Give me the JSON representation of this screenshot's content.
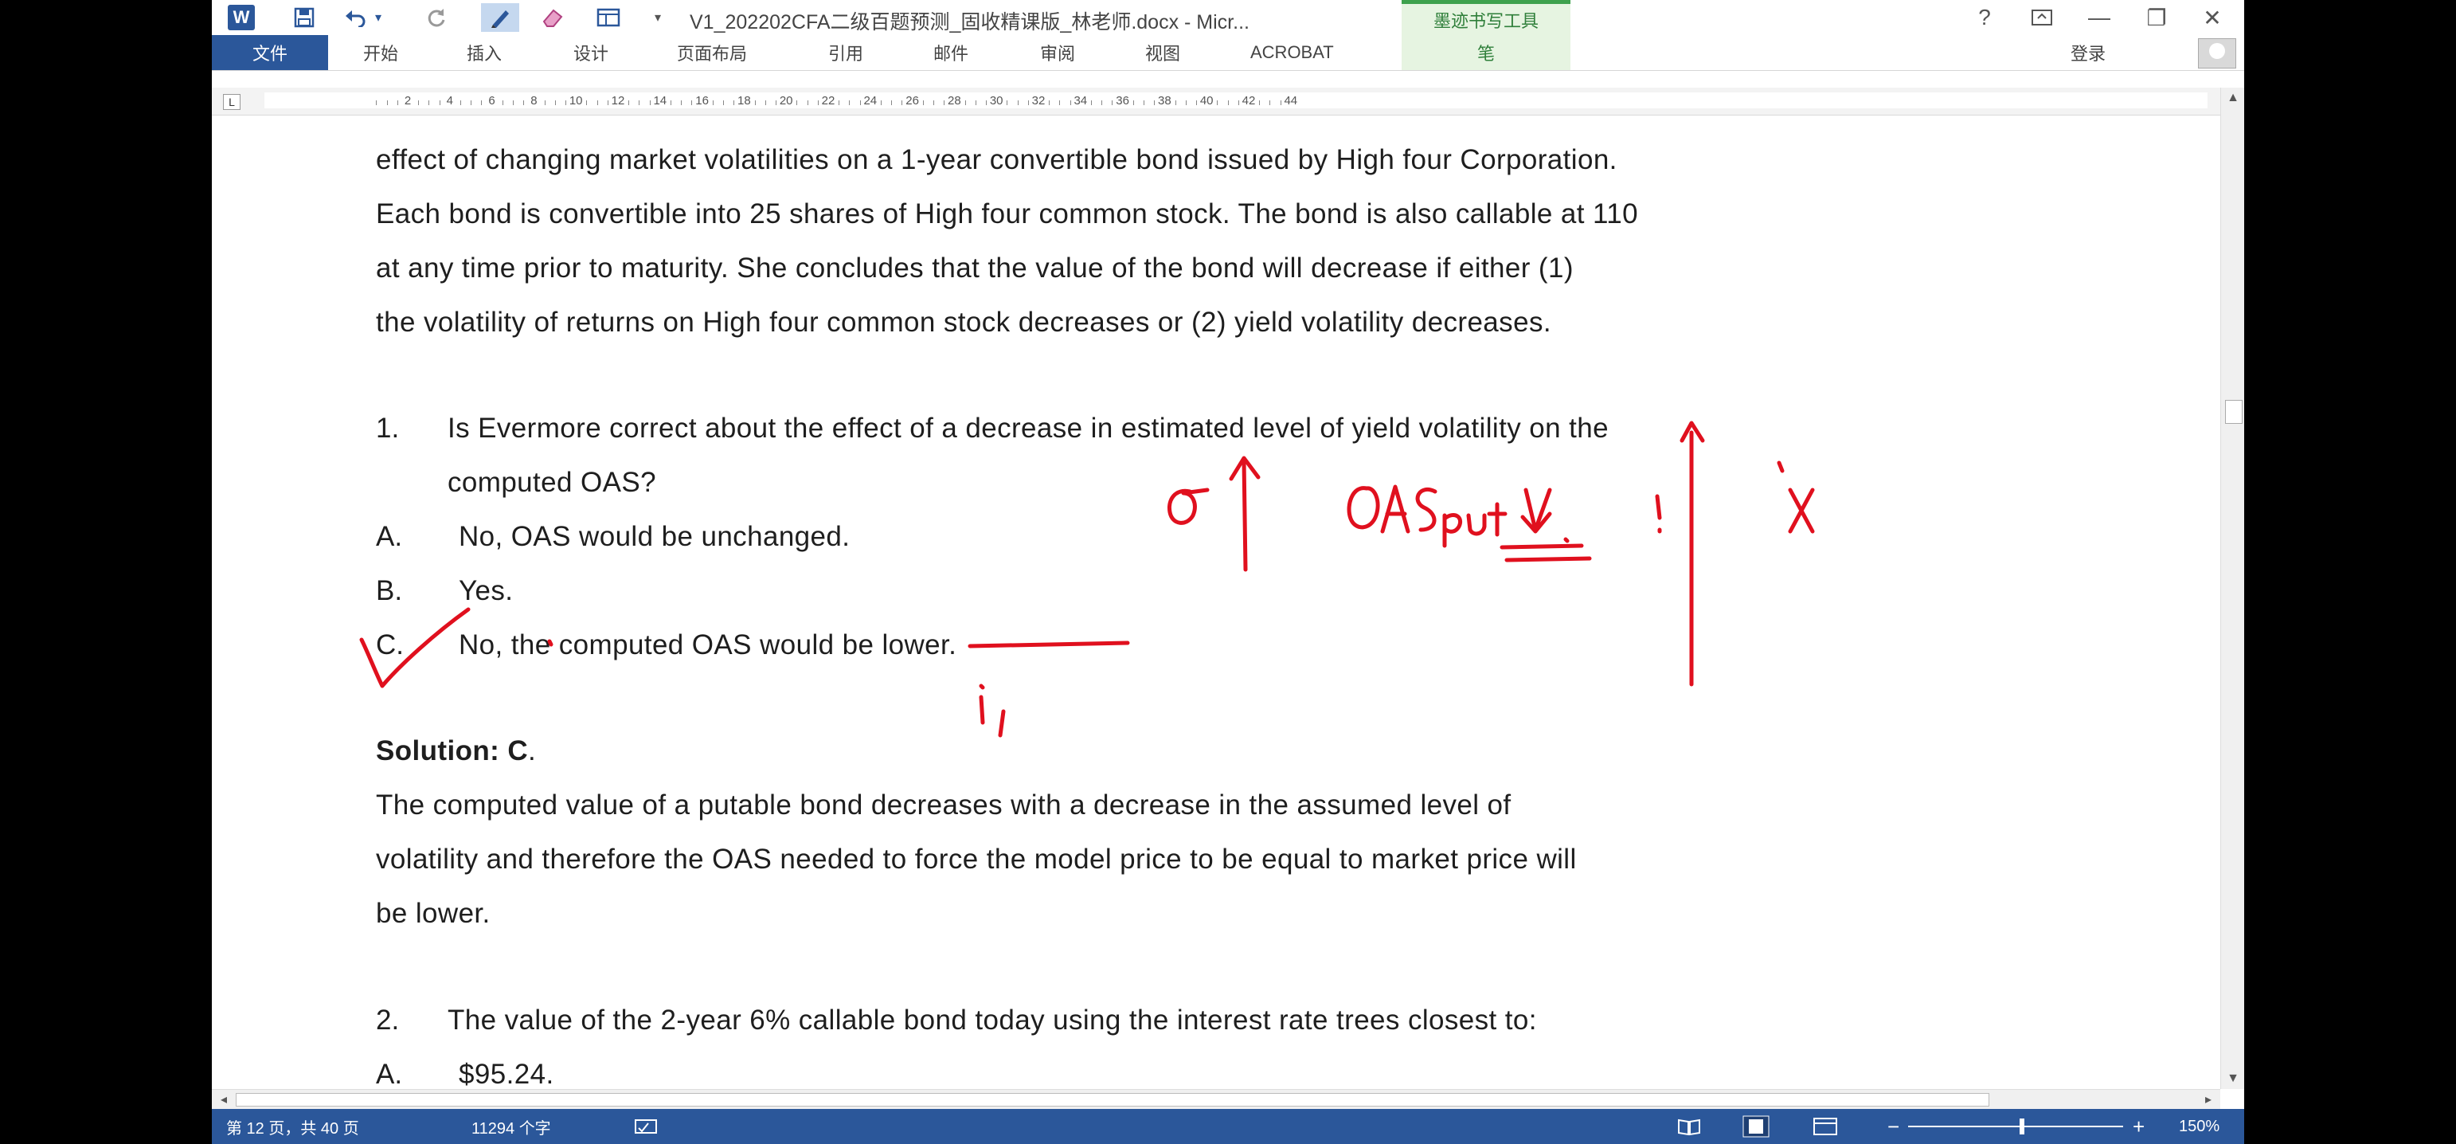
{
  "window": {
    "title": "V1_202202CFA二级百题预测_固收精课版_林老师.docx - Micr...",
    "contextual_tab_group": "墨迹书写工具",
    "help": "?",
    "minimize": "—",
    "restore": "❐",
    "close": "✕"
  },
  "quick_access": {
    "app_icon": "W",
    "save_icon": "save-icon",
    "undo_icon": "undo-icon",
    "redo_icon": "redo-icon",
    "pen_icon": "pen-icon",
    "eraser_icon": "eraser-icon",
    "layout_icon": "layout-icon",
    "customize": "▾"
  },
  "ribbon": {
    "file": "文件",
    "tabs": [
      "开始",
      "插入",
      "设计",
      "页面布局",
      "引用",
      "邮件",
      "审阅",
      "视图",
      "ACROBAT"
    ],
    "pen_tab": "笔",
    "sign_in": "登录"
  },
  "ruler": {
    "corner": "L",
    "labels": [
      "2",
      "4",
      "6",
      "8",
      "10",
      "12",
      "14",
      "16",
      "18",
      "20",
      "22",
      "24",
      "26",
      "28",
      "30",
      "32",
      "34",
      "36",
      "38",
      "40",
      "42",
      "44"
    ]
  },
  "document": {
    "intro": [
      "effect of changing market volatilities on a 1-year convertible bond issued by High four Corporation.",
      "Each bond is convertible into 25 shares of High four common stock. The bond is also callable at 110",
      "at any time prior to maturity. She concludes that the value of the bond will decrease if either (1)",
      "the volatility of returns on High four common stock decreases or (2) yield volatility decreases."
    ],
    "q1": {
      "number": "1.",
      "text_line1": "Is Evermore correct about the effect of a decrease in estimated level of yield volatility on the",
      "text_line2": "computed OAS?",
      "options": [
        {
          "letter": "A.",
          "text": "No, OAS would be unchanged."
        },
        {
          "letter": "B.",
          "text": "Yes."
        },
        {
          "letter": "C.",
          "text": "No, the computed OAS would be lower."
        }
      ]
    },
    "solution": {
      "label": "Solution: C",
      "period": ".",
      "lines": [
        "The computed value of a putable bond decreases with a decrease in the assumed level of",
        "volatility and therefore the OAS needed to force the model price to be equal to market price will",
        "be lower."
      ]
    },
    "q2": {
      "number": "2.",
      "text": "The value of the 2-year 6% callable bond today using the interest rate trees closest to:",
      "option_a_letter": "A.",
      "option_a_text": "$95.24."
    },
    "ink_annotations": {
      "sigma": "σ",
      "oas": "OAS",
      "put": "put",
      "x": "X",
      "check": "✓"
    }
  },
  "status": {
    "page": "第 12 页，共 40 页",
    "words": "11294 个字",
    "zoom": "150%",
    "zoom_minus": "−",
    "zoom_plus": "+"
  },
  "colors": {
    "accent": "#2b579a",
    "ink": "#e0101e",
    "pen_tab": "#e6f4e1"
  }
}
